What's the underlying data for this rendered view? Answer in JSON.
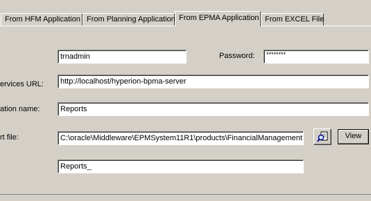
{
  "tabs": [
    {
      "label": "From HFM Application",
      "active": false
    },
    {
      "label": "From Planning Application",
      "active": false
    },
    {
      "label": "From EPMA Application",
      "active": true
    },
    {
      "label": "From EXCEL File",
      "active": false
    }
  ],
  "form": {
    "username_value": "trnadmin",
    "password_label": "Password:",
    "password_value": "********",
    "services_url_label": "ervices URL:",
    "services_url_value": "http://localhost/hyperion-bpma-server",
    "application_name_label": "ation name:",
    "application_name_value": "Reports",
    "file_label": "rt file:",
    "file_value": "C:\\oracle\\Middleware\\EPMSystem11R1\\products\\FinancialManagement",
    "view_label": "View",
    "name_value": "Reports_"
  },
  "icons": {
    "browse": "browse-search-icon"
  }
}
